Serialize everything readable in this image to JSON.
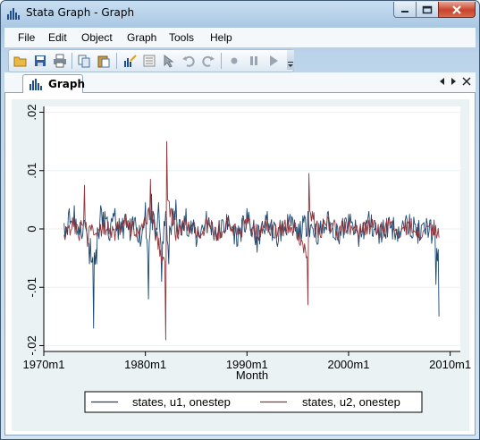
{
  "window": {
    "title": "Stata Graph - Graph"
  },
  "menu": [
    "File",
    "Edit",
    "Object",
    "Graph",
    "Tools",
    "Help"
  ],
  "toolbar": {
    "buttons": [
      "open-icon",
      "save-icon",
      "print-icon",
      "copy-icon",
      "paste-icon",
      "graph-editor-icon",
      "object-browser-icon",
      "pointer-icon",
      "undo-icon",
      "redo-icon",
      "record-icon",
      "pause-icon",
      "play-icon"
    ]
  },
  "tab": {
    "label": "Graph"
  },
  "chart_data": {
    "type": "line",
    "xlabel": "Month",
    "ylabel": "",
    "xlim": [
      1970,
      2011
    ],
    "ylim": [
      -0.021,
      0.021
    ],
    "x_ticks": [
      "1970m1",
      "1980m1",
      "1990m1",
      "2000m1",
      "2010m1"
    ],
    "y_ticks": [
      ".02",
      ".01",
      "0",
      "-.01",
      "-.02"
    ],
    "grid": true,
    "legend_position": "bottom",
    "series": [
      {
        "name": "states, u1, onestep",
        "color": "#1a476f",
        "x_range": [
          1972.0,
          2008.9
        ],
        "points": [
          [
            1972.0,
            0.001
          ],
          [
            1972.5,
            0.0035
          ],
          [
            1973.0,
            0.004
          ],
          [
            1973.5,
            -0.001
          ],
          [
            1974.0,
            0.0015
          ],
          [
            1974.5,
            -0.006
          ],
          [
            1974.9,
            -0.017
          ],
          [
            1975.2,
            -0.006
          ],
          [
            1975.6,
            0.004
          ],
          [
            1976.0,
            0.003
          ],
          [
            1976.5,
            -0.002
          ],
          [
            1977.0,
            0.0035
          ],
          [
            1977.5,
            -0.001
          ],
          [
            1978.0,
            0.0025
          ],
          [
            1978.5,
            -0.002
          ],
          [
            1979.0,
            0.002
          ],
          [
            1979.5,
            -0.003
          ],
          [
            1980.0,
            0.0045
          ],
          [
            1980.3,
            -0.012
          ],
          [
            1980.6,
            0.006
          ],
          [
            1981.0,
            -0.002
          ],
          [
            1981.3,
            0.0045
          ],
          [
            1981.6,
            -0.009
          ],
          [
            1982.0,
            0.003
          ],
          [
            1982.3,
            -0.006
          ],
          [
            1982.7,
            0.0035
          ],
          [
            1983.0,
            0.005
          ],
          [
            1983.5,
            -0.001
          ],
          [
            1984.0,
            0.0035
          ],
          [
            1985.0,
            -0.003
          ],
          [
            1986.0,
            0.003
          ],
          [
            1987.0,
            -0.002
          ],
          [
            1988.0,
            0.0025
          ],
          [
            1989.0,
            -0.003
          ],
          [
            1990.0,
            0.0035
          ],
          [
            1991.0,
            -0.004
          ],
          [
            1992.0,
            0.003
          ],
          [
            1993.0,
            -0.003
          ],
          [
            1994.0,
            0.0025
          ],
          [
            1995.0,
            -0.002
          ],
          [
            1996.0,
            0.003
          ],
          [
            1997.0,
            -0.0025
          ],
          [
            1998.0,
            0.003
          ],
          [
            1999.0,
            -0.002
          ],
          [
            2000.0,
            0.0025
          ],
          [
            2001.0,
            -0.003
          ],
          [
            2002.0,
            0.003
          ],
          [
            2003.0,
            -0.0025
          ],
          [
            2004.0,
            0.002
          ],
          [
            2005.0,
            -0.0015
          ],
          [
            2006.0,
            0.0025
          ],
          [
            2007.0,
            -0.002
          ],
          [
            2008.0,
            0.0015
          ],
          [
            2008.6,
            -0.0095
          ],
          [
            2008.9,
            -0.015
          ]
        ]
      },
      {
        "name": "states, u2, onestep",
        "color": "#90353b",
        "x_range": [
          1972.0,
          2008.9
        ],
        "points": [
          [
            1972.0,
            -0.001
          ],
          [
            1973.0,
            0.002
          ],
          [
            1973.5,
            -0.002
          ],
          [
            1974.0,
            0.0075
          ],
          [
            1974.3,
            -0.003
          ],
          [
            1975.0,
            -0.001
          ],
          [
            1976.0,
            0.0015
          ],
          [
            1977.0,
            -0.002
          ],
          [
            1978.0,
            0.0025
          ],
          [
            1979.0,
            -0.001
          ],
          [
            1980.0,
            0.0015
          ],
          [
            1980.5,
            0.0085
          ],
          [
            1981.0,
            -0.002
          ],
          [
            1982.0,
            -0.019
          ],
          [
            1982.1,
            0.015
          ],
          [
            1983.0,
            -0.002
          ],
          [
            1984.0,
            0.0015
          ],
          [
            1985.0,
            -0.0015
          ],
          [
            1986.0,
            0.002
          ],
          [
            1987.0,
            -0.002
          ],
          [
            1988.0,
            0.0015
          ],
          [
            1989.0,
            -0.001
          ],
          [
            1990.0,
            0.002
          ],
          [
            1991.0,
            -0.002
          ],
          [
            1992.0,
            0.0015
          ],
          [
            1993.0,
            -0.001
          ],
          [
            1994.0,
            0.002
          ],
          [
            1995.0,
            -0.0015
          ],
          [
            1996.0,
            -0.013
          ],
          [
            1996.1,
            0.0095
          ],
          [
            1997.0,
            -0.0015
          ],
          [
            1998.0,
            0.002
          ],
          [
            1999.0,
            -0.0015
          ],
          [
            2000.0,
            0.0015
          ],
          [
            2001.0,
            -0.002
          ],
          [
            2002.0,
            0.0015
          ],
          [
            2003.0,
            -0.0015
          ],
          [
            2004.0,
            0.002
          ],
          [
            2005.0,
            -0.0015
          ],
          [
            2006.0,
            0.0015
          ],
          [
            2007.0,
            -0.0015
          ],
          [
            2008.0,
            0.001
          ],
          [
            2008.9,
            -0.0015
          ]
        ]
      }
    ]
  }
}
